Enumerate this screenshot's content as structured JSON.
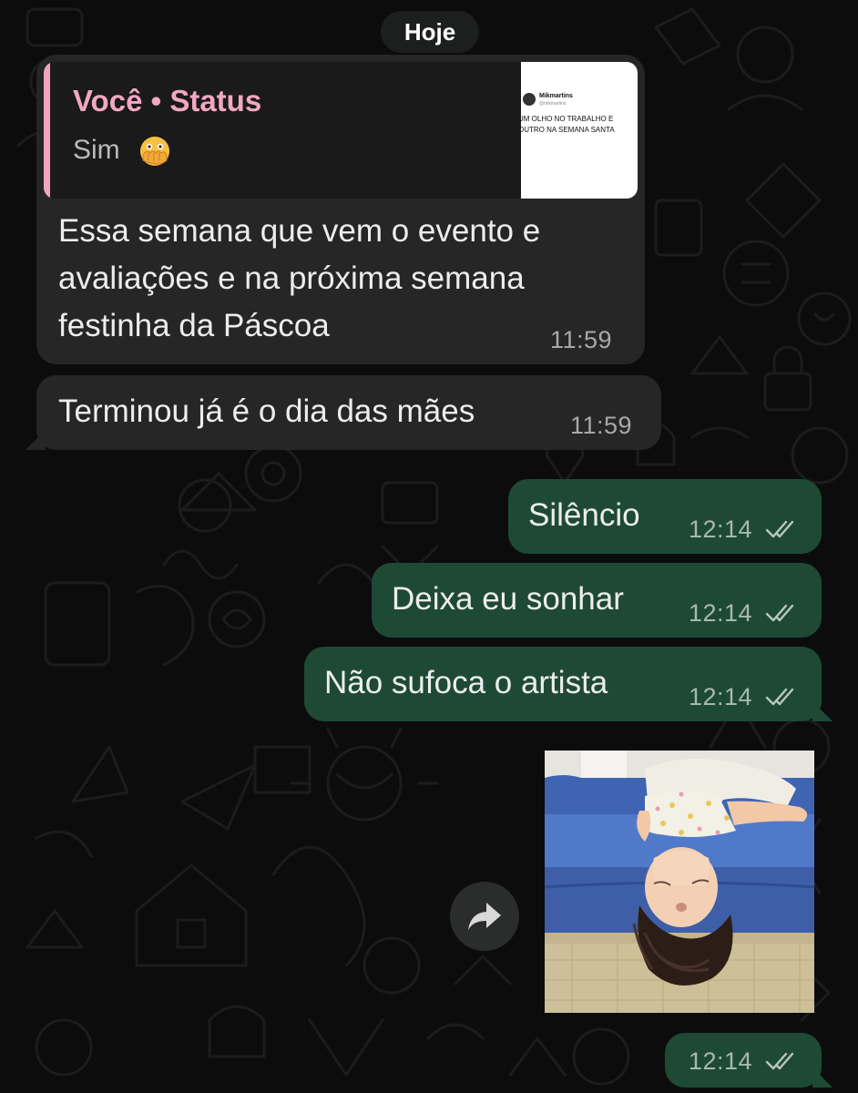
{
  "date_label": "Hoje",
  "messages": [
    {
      "direction": "incoming",
      "reply": {
        "author": "Você • Status",
        "text": "Sim",
        "emoji": "face-with-open-eyes-and-hand-over-mouth",
        "thumbnail": {
          "username": "Mikmartins",
          "handle": "@mikmartins",
          "lines": [
            "UM OLHO NO TRABALHO E",
            "OUTRO NA SEMANA SANTA"
          ]
        }
      },
      "text": "Essa semana que vem o evento e\navaliações e na próxima semana\nfestinha da Páscoa",
      "time": "11:59"
    },
    {
      "direction": "incoming",
      "text": "Terminou já é o dia das mães",
      "time": "11:59"
    },
    {
      "direction": "outgoing",
      "text": "Silêncio",
      "time": "12:14",
      "status": "read"
    },
    {
      "direction": "outgoing",
      "text": "Deixa eu sonhar",
      "time": "12:14",
      "status": "read"
    },
    {
      "direction": "outgoing",
      "text": "Não sufoca o artista",
      "time": "12:14",
      "status": "read"
    },
    {
      "direction": "outgoing",
      "type": "photo",
      "photo_subject": "child lying upside down on a blue sofa",
      "time": "12:14",
      "status": "read"
    }
  ],
  "icons": {
    "forward": "forward-arrow-icon",
    "read_receipt": "double-check-icon"
  },
  "colors": {
    "background": "#0c0c0c",
    "incoming_bubble": "#262626",
    "outgoing_bubble": "#1e4a35",
    "quote_author": "#f2a7c3",
    "timestamp": "#a7a9a8"
  }
}
